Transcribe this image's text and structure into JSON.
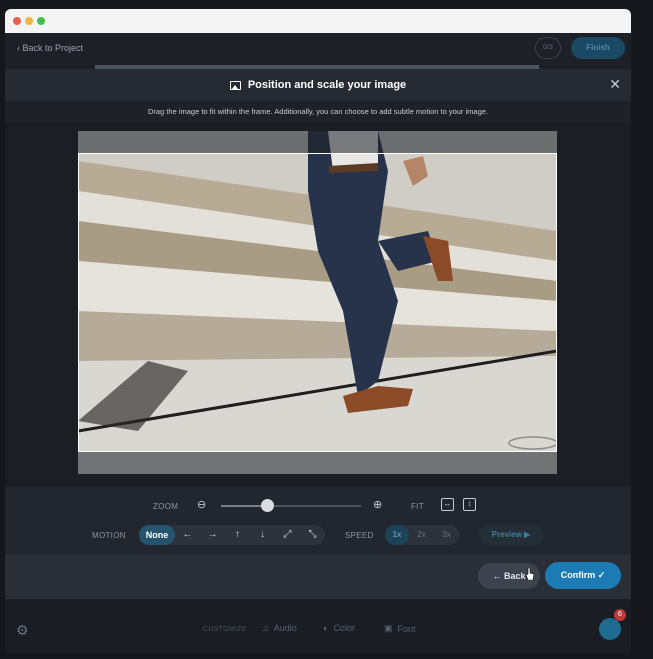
{
  "titlebar": {
    "buttons": [
      "close",
      "minimize",
      "maximize"
    ]
  },
  "appbar": {
    "back_label": "Back to Project",
    "count_badge": "0/3",
    "finish_label": "Finish"
  },
  "modal": {
    "title": "Position and scale your image",
    "subtitle": "Drag the image to fit within the frame. Additionally, you can choose to add subtle motion to your image.",
    "close_icon": "close-icon"
  },
  "controls": {
    "zoom_label": "ZOOM",
    "zoom_level": 0.33,
    "fit_label": "FIT",
    "motion_label": "MOTION",
    "motion_options": [
      "None",
      "←",
      "→",
      "↑",
      "↓",
      "⤢",
      "⤡"
    ],
    "motion_selected": "None",
    "speed_label": "SPEED",
    "speed_options": [
      "1x",
      "2x",
      "3x"
    ],
    "speed_selected": "1x",
    "preview_label": "Preview"
  },
  "footer": {
    "back_label": "Back",
    "confirm_label": "Confirm"
  },
  "bottombar": {
    "customize_label": "CUSTOMIZE",
    "items": [
      {
        "label": "Audio",
        "icon": "music-note-icon"
      },
      {
        "label": "Color",
        "icon": "palette-icon"
      },
      {
        "label": "Font",
        "icon": "font-icon"
      }
    ],
    "notification_count": "6"
  },
  "colors": {
    "accent": "#1c7bb5",
    "active_segment": "#24546e"
  }
}
